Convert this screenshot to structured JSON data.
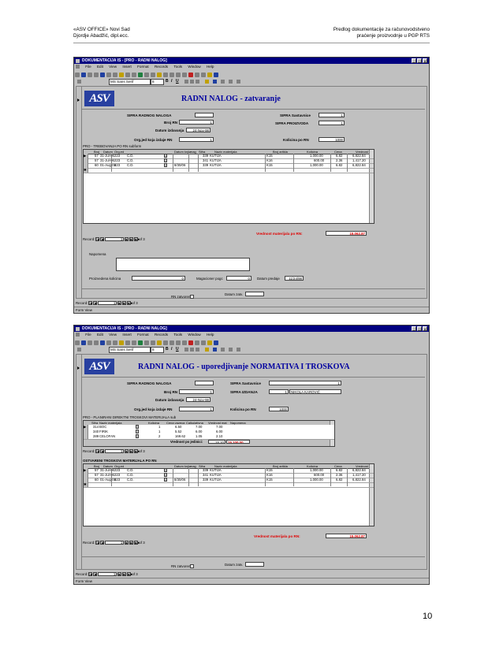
{
  "header": {
    "left_line1": "«ASV OFFICE» Novi Sad",
    "left_line2": "Djordje Abadžić, dipl.ecc.",
    "right_line1": "Predlog dokumentacije za računovodstveno",
    "right_line2": "praćenje proizvodnje u PGP RTS"
  },
  "page_number": "10",
  "menu": [
    "File",
    "Edit",
    "View",
    "Insert",
    "Format",
    "Records",
    "Tools",
    "Window",
    "Help"
  ],
  "font_name": "MS Sans Serif",
  "font_size": "8",
  "logo_text": "ASV",
  "window1": {
    "title": "DOKUMENTACIJA IS - [PRO - RADNI NALOG]",
    "form_title": "RADNI NALOG - zatvaranje",
    "sifra_rn_label": "SIFRA RADNOG NALOGA",
    "sifra_rn_value": "",
    "broj_rn_label": "Broj RN",
    "broj_rn_value": "1",
    "datum_label": "Datum izdavanja",
    "datum_value": "24-Nov-98",
    "org_label": "Org.jed koja izdaje RN",
    "org_value": "1",
    "sastavnica_label": "SIFRA Sastavnice",
    "sastavnica_value": "1",
    "proizvoda_label": "SIFRA PROIZVODA",
    "proizvoda_value": "1",
    "kolicina_label": "Kolicina po RN",
    "kolicina_value": "1000",
    "subform_caption": "PRO - TREBOVANJA PO RN subform",
    "grid_headers": [
      "Broj",
      "Datum",
      "Org.ed",
      "",
      "Datum knjiz",
      "mag",
      "Sifra",
      "Naziv materijala",
      "Broj artikla",
      "Kolicina",
      "Cena",
      "Vrednost"
    ],
    "grid_rows": [
      [
        "57",
        "31-Jul-06",
        "223",
        "C.D.",
        "",
        "",
        "339",
        "KUTIJA",
        "K15",
        "1,000.00",
        "6.82",
        "6,822.84"
      ],
      [
        "57",
        "31-Jul-06",
        "223",
        "C.D.",
        "",
        "",
        "341",
        "KUTIJA",
        "K16",
        "600.00",
        "2.36",
        "1,417.20"
      ],
      [
        "60",
        "01-Aug-06",
        "223",
        "C.D.",
        "8/30/06",
        "",
        "339",
        "KUTIJA",
        "K15",
        "1,000.00",
        "6.82",
        "6,822.84"
      ]
    ],
    "vrednost_label": "Vrednost materijala po RN:",
    "vrednost_value": "15,062.87",
    "sub_record_label": "Record:",
    "sub_record_value": "1",
    "sub_record_of": "of  3",
    "napomena_label": "Napomena",
    "proizvedena_label": "Proizvedena kolicina",
    "proizvedena_value": "0",
    "magacioner_label": "Magacioner pogc",
    "magacioner_value": "0",
    "datum_predaje_label": "Datum predaje",
    "datum_predaje_value": "11/24/98",
    "rn_zatvoren_label": "RN zatvoren",
    "datum_zatv_label": "Datum zatv.",
    "record_label": "Record:",
    "record_value": "1",
    "record_of": "of  3",
    "status": "Form View"
  },
  "window2": {
    "title": "DOKUMENTACIJA IS - [PRO - RADNI NALOG]",
    "form_title": "RADNI NALOG - uporedjivanje NORMATIVA I TROSKOVA",
    "sifra_rn_label": "SIFRA RADNOG NALOGA",
    "sifra_rn_value": "",
    "broj_rn_label": "Broj RN",
    "broj_rn_value": "1",
    "datum_label": "Datum izdavanja",
    "datum_value": "24-Nov-98",
    "org_label": "Org.jed koja izdaje RN",
    "org_value": "1",
    "sastavnica_label": "SIFRA Sastavnice",
    "sastavnica_value": "1",
    "izdanja_label": "SIFRA IZDANJA",
    "izdanja_value": "1",
    "izdanja_name": "NIKOLA KAROVIĆ",
    "kolicina_label": "Kolicina po RN",
    "kolicina_value": "1000",
    "plan_caption": "PRO - PLANIRANI DIREKTNI TROSKOVI MATERIJALA sub",
    "plan_headers": [
      "Sifra",
      "Naziv materijala",
      "Kolicina",
      "Cena vazeca",
      "Calkulativna",
      "Vrednost mat",
      "Napomena"
    ],
    "plan_rows": [
      [
        "314",
        "BOC",
        "1",
        "6.50",
        "7.00",
        "7.00",
        ""
      ],
      [
        "340",
        "FIRIK",
        "1",
        "5.52",
        "6.00",
        "6.00",
        ""
      ],
      [
        "289",
        "CELOFAN",
        "2",
        "169.62",
        "1.05",
        "2.10",
        ""
      ]
    ],
    "plan_total_label": "Vrednost po jedinici:",
    "plan_total_value": "15.10",
    "plan_total_rn": "15,100.00",
    "plan_record_label": "Record:",
    "plan_record_value": "1",
    "plan_record_of": "of  3",
    "actual_caption": "OSTVARENI TROSKOVI MATERIJALA PO RN",
    "grid_headers": [
      "Broj",
      "Datum",
      "Org.ed",
      "",
      "Datum knjiz",
      "mag",
      "Sifra",
      "Naziv materijala",
      "Broj artikla",
      "Kolicina",
      "Cena",
      "Vrednost"
    ],
    "grid_rows": [
      [
        "57",
        "31-Jul-06",
        "223",
        "C.D.",
        "",
        "",
        "339",
        "KUTIJA",
        "K15",
        "1,000.00",
        "6.82",
        "6,822.84"
      ],
      [
        "57",
        "31-Jul-06",
        "223",
        "C.D.",
        "",
        "",
        "341",
        "KUTIJA",
        "K16",
        "600.00",
        "2.36",
        "1,417.20"
      ],
      [
        "60",
        "01-Aug-06",
        "223",
        "C.D.",
        "8/30/06",
        "",
        "339",
        "KUTIJA",
        "K15",
        "1,000.00",
        "6.82",
        "6,822.84"
      ]
    ],
    "vrednost_label": "Vrednost materijala po RN:",
    "vrednost_value": "15,062.87",
    "sub_record_label": "Record:",
    "sub_record_value": "1",
    "sub_record_of": "of  3",
    "rn_zatvoren_label": "RN zatvoren",
    "datum_zatv_label": "Datum zatv.",
    "record_label": "Record:",
    "record_value": "1",
    "record_of": "of  3",
    "status": "Form View"
  }
}
